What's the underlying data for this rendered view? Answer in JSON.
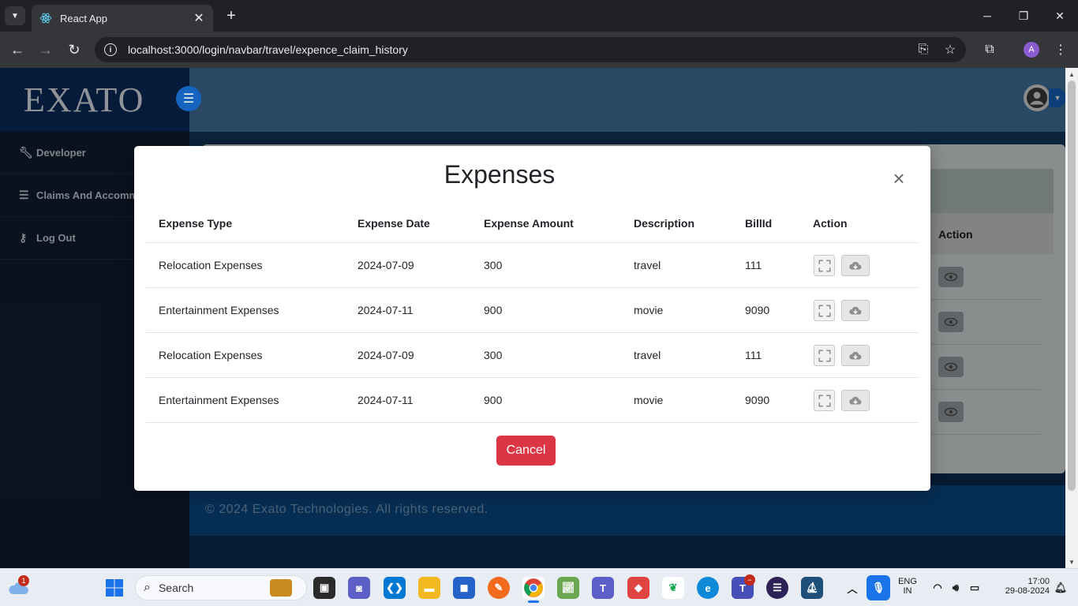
{
  "browser": {
    "tab_title": "React App",
    "tab_close": "✕",
    "new_tab": "+",
    "url": "localhost:3000/login/navbar/travel/expence_claim_history",
    "profile_initial": "A"
  },
  "sidebar": {
    "brand": "EXATO",
    "items": [
      {
        "label": "Developer",
        "icon": "wrench-icon"
      },
      {
        "label": "Claims And Accommodation",
        "icon": "checklist-icon"
      },
      {
        "label": "Log Out",
        "icon": "key-icon"
      }
    ]
  },
  "background_table": {
    "action_header": "Action"
  },
  "footer": {
    "text": "© 2024 Exato Technologies. All rights reserved."
  },
  "modal": {
    "title": "Expenses",
    "close_label": "×",
    "columns": [
      "Expense Type",
      "Expense Date",
      "Expense Amount",
      "Description",
      "BillId",
      "Action"
    ],
    "rows": [
      {
        "type": "Relocation Expenses",
        "date": "2024-07-09",
        "amount": "300",
        "description": "travel",
        "bill_id": "111"
      },
      {
        "type": "Entertainment Expenses",
        "date": "2024-07-11",
        "amount": "900",
        "description": "movie",
        "bill_id": "9090"
      },
      {
        "type": "Relocation Expenses",
        "date": "2024-07-09",
        "amount": "300",
        "description": "travel",
        "bill_id": "111"
      },
      {
        "type": "Entertainment Expenses",
        "date": "2024-07-11",
        "amount": "900",
        "description": "movie",
        "bill_id": "9090"
      }
    ],
    "cancel_label": "Cancel"
  },
  "taskbar": {
    "search_placeholder": "Search",
    "weather_badge": "1",
    "language_line1": "ENG",
    "language_line2": "IN",
    "time": "17:00",
    "date": "29-08-2024"
  },
  "colors": {
    "cancel": "#dc3545",
    "topbar": "#4477a3",
    "sidebar": "#111d33",
    "brand_bg": "#0b2d5c"
  }
}
